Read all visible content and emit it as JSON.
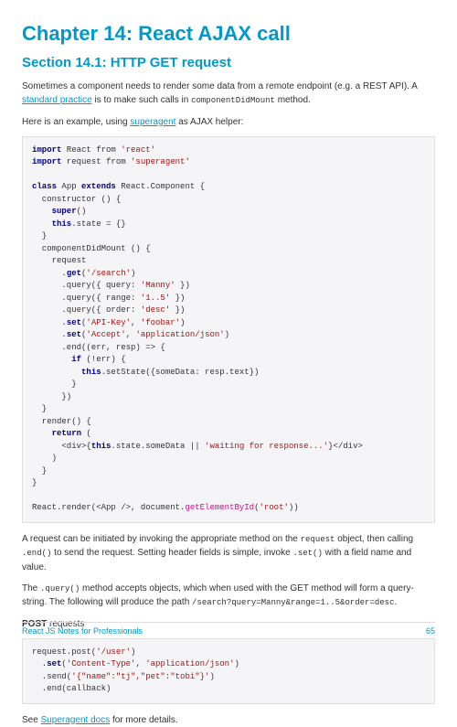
{
  "chapter_title": "Chapter 14: React AJAX call",
  "section_title": "Section 14.1: HTTP GET request",
  "para1_a": "Sometimes a component needs to render some data from a remote endpoint (e.g. a REST API). A ",
  "para1_link": "standard practice",
  "para1_b": " is to make such calls in ",
  "para1_code": "componentDidMount",
  "para1_c": " method.",
  "para2_a": "Here is an example, using ",
  "para2_link": "superagent",
  "para2_b": " as AJAX helper:",
  "para3_a": "A request can be initiated by invoking the appropriate method on the ",
  "para3_code1": "request",
  "para3_b": " object, then calling ",
  "para3_code2": ".end()",
  "para3_c": " to send the request. Setting header fields is simple, invoke ",
  "para3_code3": ".set()",
  "para3_d": " with a field name and value.",
  "para4_a": "The ",
  "para4_code": ".query()",
  "para4_b": " method accepts objects, which when used with the GET method will form a query-string. The following will produce the path ",
  "para4_path": "/search?query=Manny&range=1..5&order=desc",
  "para4_c": ".",
  "post_label": "POST",
  "post_suffix": " requests",
  "para6_a": "See ",
  "para6_link": "Superagent docs",
  "para6_b": " for more details.",
  "footer_text": "React JS Notes for Professionals",
  "page_number": "65"
}
